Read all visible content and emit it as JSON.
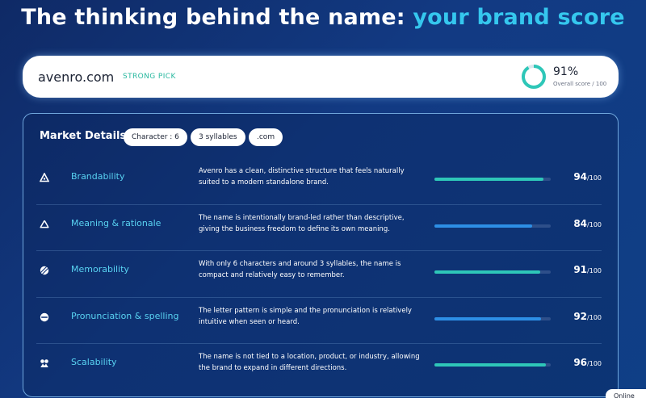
{
  "headline": {
    "main": "The thinking behind the name: ",
    "accent": "your brand score"
  },
  "domain": {
    "name": "avenro.com",
    "tag": "STRONG PICK",
    "score": 91,
    "score_text": "91%",
    "score_caption": "Overall score / 100"
  },
  "market": {
    "title": "Market Details",
    "chips": [
      "Character : 6",
      "3 syllables",
      ".com"
    ],
    "score_denominator": "/100",
    "rows": [
      {
        "icon": "brandability-icon",
        "label": "Brandability",
        "description": "Avenro has a clean, distinctive structure that feels naturally suited to a modern standalone brand.",
        "score": 94,
        "color": "#2ec7b8"
      },
      {
        "icon": "recycle-icon",
        "label": "Meaning & rationale",
        "description": "The name is intentionally brand-led rather than descriptive, giving the business freedom to define its own meaning.",
        "score": 84,
        "color": "#2d8fe6"
      },
      {
        "icon": "striped-circle-icon",
        "label": "Memorability",
        "description": "With only 6 characters and around 3 syllables, the name is compact and relatively easy to remember.",
        "score": 91,
        "color": "#2ec7b8"
      },
      {
        "icon": "speech-circle-icon",
        "label": "Pronunciation & spelling",
        "description": "The letter pattern is simple and the pronunciation is relatively intuitive when seen or heard.",
        "score": 92,
        "color": "#2d8fe6"
      },
      {
        "icon": "scale-icon",
        "label": "Scalability",
        "description": "The name is not tied to a location, product, or industry, allowing the brand to expand in different directions.",
        "score": 96,
        "color": "#2ec7b8"
      }
    ]
  },
  "status": {
    "online": "Online"
  }
}
